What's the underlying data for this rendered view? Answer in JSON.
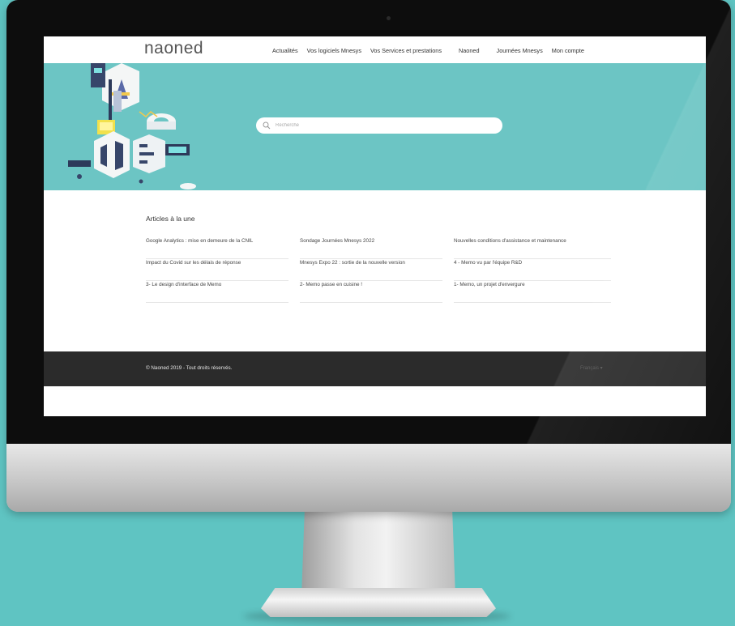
{
  "header": {
    "logo_text": "naoned",
    "nav": [
      "Actualités",
      "Vos logiciels Mnesys",
      "Vos Services et prestations",
      "Naoned",
      "Journées Mnesys",
      "Mon compte"
    ]
  },
  "hero": {
    "search_placeholder": "Recherche",
    "background_color": "#6cc5c4"
  },
  "articles": {
    "title": "Articles à la une",
    "items": [
      "Google Analytics : mise en demeure de la CNIL",
      "Sondage Journées Mnesys 2022",
      "Nouvelles conditions d'assistance et maintenance",
      "Impact du Covid sur les délais de réponse",
      "Mnesys Expo 22 : sortie de la nouvelle version",
      "4 - Memo vu par l'équipe R&D",
      "3- Le design d'interface de Memo",
      "2- Memo passe en cuisine !",
      "1- Memo, un projet d'envergure"
    ]
  },
  "footer": {
    "copyright": "© Naoned 2019 - Tout droits réservés.",
    "language": "Français ▾"
  },
  "colors": {
    "page_background": "#5fc4c2",
    "footer": "#2b2b2b"
  }
}
